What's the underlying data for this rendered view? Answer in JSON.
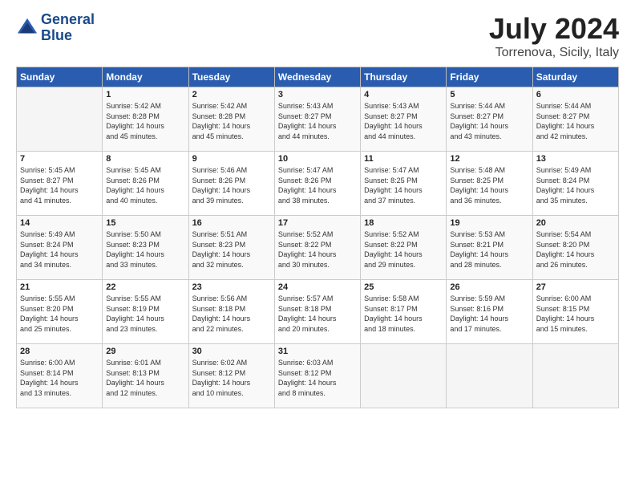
{
  "logo": {
    "line1": "General",
    "line2": "Blue"
  },
  "header": {
    "month_year": "July 2024",
    "location": "Torrenova, Sicily, Italy"
  },
  "weekdays": [
    "Sunday",
    "Monday",
    "Tuesday",
    "Wednesday",
    "Thursday",
    "Friday",
    "Saturday"
  ],
  "weeks": [
    [
      {
        "day": "",
        "sunrise": "",
        "sunset": "",
        "daylight": ""
      },
      {
        "day": "1",
        "sunrise": "Sunrise: 5:42 AM",
        "sunset": "Sunset: 8:28 PM",
        "daylight": "Daylight: 14 hours and 45 minutes."
      },
      {
        "day": "2",
        "sunrise": "Sunrise: 5:42 AM",
        "sunset": "Sunset: 8:28 PM",
        "daylight": "Daylight: 14 hours and 45 minutes."
      },
      {
        "day": "3",
        "sunrise": "Sunrise: 5:43 AM",
        "sunset": "Sunset: 8:27 PM",
        "daylight": "Daylight: 14 hours and 44 minutes."
      },
      {
        "day": "4",
        "sunrise": "Sunrise: 5:43 AM",
        "sunset": "Sunset: 8:27 PM",
        "daylight": "Daylight: 14 hours and 44 minutes."
      },
      {
        "day": "5",
        "sunrise": "Sunrise: 5:44 AM",
        "sunset": "Sunset: 8:27 PM",
        "daylight": "Daylight: 14 hours and 43 minutes."
      },
      {
        "day": "6",
        "sunrise": "Sunrise: 5:44 AM",
        "sunset": "Sunset: 8:27 PM",
        "daylight": "Daylight: 14 hours and 42 minutes."
      }
    ],
    [
      {
        "day": "7",
        "sunrise": "Sunrise: 5:45 AM",
        "sunset": "Sunset: 8:27 PM",
        "daylight": "Daylight: 14 hours and 41 minutes."
      },
      {
        "day": "8",
        "sunrise": "Sunrise: 5:45 AM",
        "sunset": "Sunset: 8:26 PM",
        "daylight": "Daylight: 14 hours and 40 minutes."
      },
      {
        "day": "9",
        "sunrise": "Sunrise: 5:46 AM",
        "sunset": "Sunset: 8:26 PM",
        "daylight": "Daylight: 14 hours and 39 minutes."
      },
      {
        "day": "10",
        "sunrise": "Sunrise: 5:47 AM",
        "sunset": "Sunset: 8:26 PM",
        "daylight": "Daylight: 14 hours and 38 minutes."
      },
      {
        "day": "11",
        "sunrise": "Sunrise: 5:47 AM",
        "sunset": "Sunset: 8:25 PM",
        "daylight": "Daylight: 14 hours and 37 minutes."
      },
      {
        "day": "12",
        "sunrise": "Sunrise: 5:48 AM",
        "sunset": "Sunset: 8:25 PM",
        "daylight": "Daylight: 14 hours and 36 minutes."
      },
      {
        "day": "13",
        "sunrise": "Sunrise: 5:49 AM",
        "sunset": "Sunset: 8:24 PM",
        "daylight": "Daylight: 14 hours and 35 minutes."
      }
    ],
    [
      {
        "day": "14",
        "sunrise": "Sunrise: 5:49 AM",
        "sunset": "Sunset: 8:24 PM",
        "daylight": "Daylight: 14 hours and 34 minutes."
      },
      {
        "day": "15",
        "sunrise": "Sunrise: 5:50 AM",
        "sunset": "Sunset: 8:23 PM",
        "daylight": "Daylight: 14 hours and 33 minutes."
      },
      {
        "day": "16",
        "sunrise": "Sunrise: 5:51 AM",
        "sunset": "Sunset: 8:23 PM",
        "daylight": "Daylight: 14 hours and 32 minutes."
      },
      {
        "day": "17",
        "sunrise": "Sunrise: 5:52 AM",
        "sunset": "Sunset: 8:22 PM",
        "daylight": "Daylight: 14 hours and 30 minutes."
      },
      {
        "day": "18",
        "sunrise": "Sunrise: 5:52 AM",
        "sunset": "Sunset: 8:22 PM",
        "daylight": "Daylight: 14 hours and 29 minutes."
      },
      {
        "day": "19",
        "sunrise": "Sunrise: 5:53 AM",
        "sunset": "Sunset: 8:21 PM",
        "daylight": "Daylight: 14 hours and 28 minutes."
      },
      {
        "day": "20",
        "sunrise": "Sunrise: 5:54 AM",
        "sunset": "Sunset: 8:20 PM",
        "daylight": "Daylight: 14 hours and 26 minutes."
      }
    ],
    [
      {
        "day": "21",
        "sunrise": "Sunrise: 5:55 AM",
        "sunset": "Sunset: 8:20 PM",
        "daylight": "Daylight: 14 hours and 25 minutes."
      },
      {
        "day": "22",
        "sunrise": "Sunrise: 5:55 AM",
        "sunset": "Sunset: 8:19 PM",
        "daylight": "Daylight: 14 hours and 23 minutes."
      },
      {
        "day": "23",
        "sunrise": "Sunrise: 5:56 AM",
        "sunset": "Sunset: 8:18 PM",
        "daylight": "Daylight: 14 hours and 22 minutes."
      },
      {
        "day": "24",
        "sunrise": "Sunrise: 5:57 AM",
        "sunset": "Sunset: 8:18 PM",
        "daylight": "Daylight: 14 hours and 20 minutes."
      },
      {
        "day": "25",
        "sunrise": "Sunrise: 5:58 AM",
        "sunset": "Sunset: 8:17 PM",
        "daylight": "Daylight: 14 hours and 18 minutes."
      },
      {
        "day": "26",
        "sunrise": "Sunrise: 5:59 AM",
        "sunset": "Sunset: 8:16 PM",
        "daylight": "Daylight: 14 hours and 17 minutes."
      },
      {
        "day": "27",
        "sunrise": "Sunrise: 6:00 AM",
        "sunset": "Sunset: 8:15 PM",
        "daylight": "Daylight: 14 hours and 15 minutes."
      }
    ],
    [
      {
        "day": "28",
        "sunrise": "Sunrise: 6:00 AM",
        "sunset": "Sunset: 8:14 PM",
        "daylight": "Daylight: 14 hours and 13 minutes."
      },
      {
        "day": "29",
        "sunrise": "Sunrise: 6:01 AM",
        "sunset": "Sunset: 8:13 PM",
        "daylight": "Daylight: 14 hours and 12 minutes."
      },
      {
        "day": "30",
        "sunrise": "Sunrise: 6:02 AM",
        "sunset": "Sunset: 8:12 PM",
        "daylight": "Daylight: 14 hours and 10 minutes."
      },
      {
        "day": "31",
        "sunrise": "Sunrise: 6:03 AM",
        "sunset": "Sunset: 8:12 PM",
        "daylight": "Daylight: 14 hours and 8 minutes."
      },
      {
        "day": "",
        "sunrise": "",
        "sunset": "",
        "daylight": ""
      },
      {
        "day": "",
        "sunrise": "",
        "sunset": "",
        "daylight": ""
      },
      {
        "day": "",
        "sunrise": "",
        "sunset": "",
        "daylight": ""
      }
    ]
  ]
}
